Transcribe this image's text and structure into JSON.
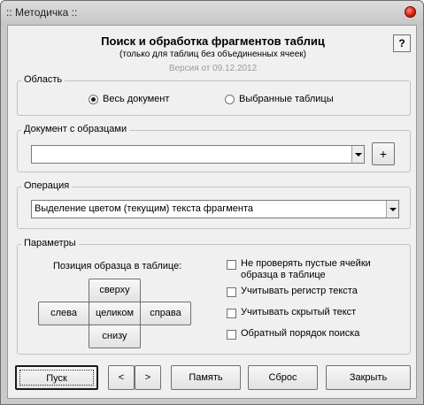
{
  "window": {
    "title": ":: Методичка ::"
  },
  "header": {
    "title": "Поиск и обработка фрагментов таблиц",
    "subtitle": "(только для таблиц без объединенных ячеек)",
    "version": "Версия от  09.12.2012",
    "help_label": "?"
  },
  "area": {
    "legend": "Область",
    "options": [
      {
        "label": "Весь документ",
        "selected": true
      },
      {
        "label": "Выбранные таблицы",
        "selected": false
      }
    ]
  },
  "sample_doc": {
    "legend": "Документ с образцами",
    "value": "",
    "add_label": "+"
  },
  "operation": {
    "legend": "Операция",
    "value": "Выделение цветом (текущим) текста фрагмента"
  },
  "params": {
    "legend": "Параметры",
    "position_label": "Позиция образца в таблице:",
    "positions": {
      "top": "сверху",
      "left": "слева",
      "center": "целиком",
      "right": "справа",
      "bottom": "снизу"
    },
    "checkboxes": [
      {
        "label": "Не проверять пустые ячейки образца в таблице",
        "checked": false
      },
      {
        "label": "Учитывать регистр текста",
        "checked": false
      },
      {
        "label": "Учитывать скрытый текст",
        "checked": false
      },
      {
        "label": "Обратный порядок поиска",
        "checked": false
      }
    ]
  },
  "buttons": {
    "start": "Пуск",
    "prev": "<",
    "next": ">",
    "memory": "Память",
    "reset": "Сброс",
    "close": "Закрыть"
  }
}
